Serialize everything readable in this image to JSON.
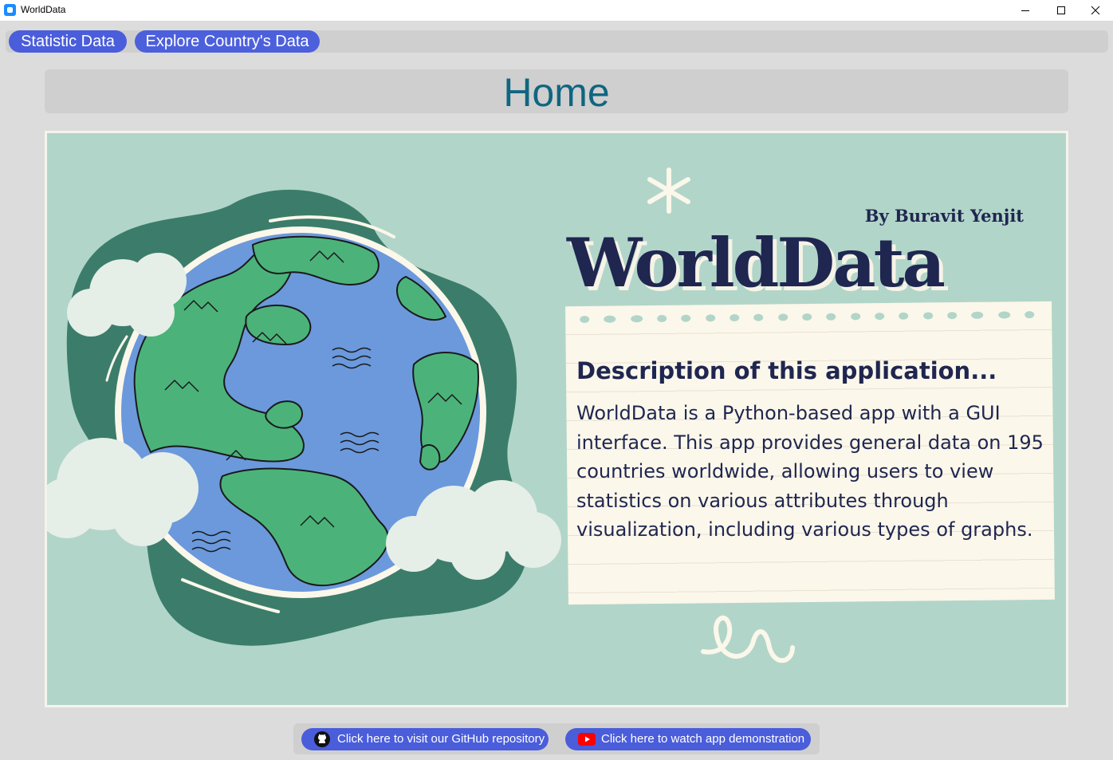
{
  "window": {
    "title": "WorldData"
  },
  "tabs": [
    {
      "label": "Statistic Data"
    },
    {
      "label": "Explore Country's Data"
    }
  ],
  "header": {
    "title": "Home"
  },
  "banner": {
    "byline": "By Buravit Yenjit",
    "brand": "WorldData",
    "description_title": "Description of this application...",
    "description_body": "WorldData is a Python-based app with a GUI interface. This app provides general data on 195 countries worldwide, allowing users to view statistics on various attributes through visualization, including various types of graphs."
  },
  "footer": {
    "github_label": "Click here to visit our GitHub repository",
    "youtube_label": "Click here to watch app demonstration"
  },
  "colors": {
    "accent": "#4a5ddb",
    "banner_bg": "#b2d5c9",
    "title_text": "#0f6680",
    "navy": "#1f2650"
  },
  "icons": [
    "app-icon",
    "minimize-icon",
    "maximize-icon",
    "close-icon",
    "github-icon",
    "youtube-icon"
  ]
}
